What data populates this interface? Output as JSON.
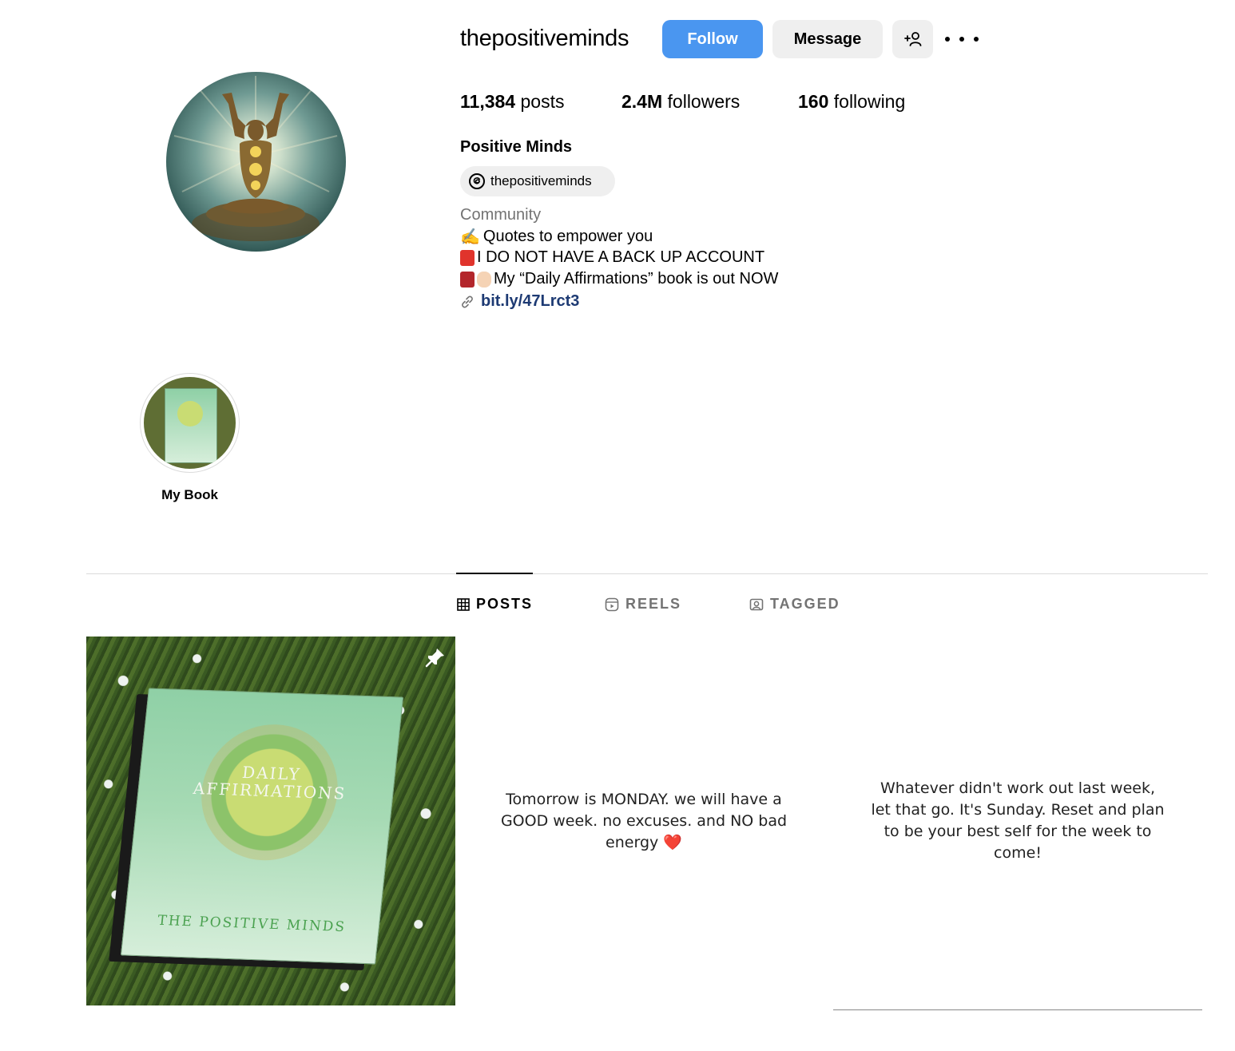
{
  "profile": {
    "username": "thepositiveminds",
    "follow_label": "Follow",
    "message_label": "Message",
    "stats": {
      "posts_count": "11,384",
      "posts_label": "posts",
      "followers_count": "2.4M",
      "followers_label": "followers",
      "following_count": "160",
      "following_label": "following"
    },
    "full_name": "Positive Minds",
    "threads_handle": "thepositiveminds",
    "category": "Community",
    "bio": {
      "line1_emoji": "✍️",
      "line1_text": "Quotes to empower you",
      "line2_text": "I DO NOT HAVE A BACK UP ACCOUNT",
      "line3_text": "My “Daily Affirmations” book is out NOW",
      "link": "bit.ly/47Lrct3"
    }
  },
  "highlights": [
    {
      "label": "My Book"
    }
  ],
  "tabs": [
    {
      "label": "POSTS",
      "active": true
    },
    {
      "label": "REELS",
      "active": false
    },
    {
      "label": "TAGGED",
      "active": false
    }
  ],
  "posts": [
    {
      "book_title_line1": "DAILY",
      "book_title_line2": "AFFIRMATIONS",
      "book_author": "THE POSITIVE MINDS",
      "pinned": true
    },
    {
      "text": "Tomorrow is MONDAY. we will have a GOOD week. no excuses. and NO bad energy ❤️"
    },
    {
      "text": "Whatever didn't work out last week, let that go. It's Sunday. Reset and plan to be your best self for the week to come!"
    }
  ],
  "colors": {
    "accent": "#4a96f0",
    "link": "#1d3a73",
    "secondary_text": "#737373"
  }
}
